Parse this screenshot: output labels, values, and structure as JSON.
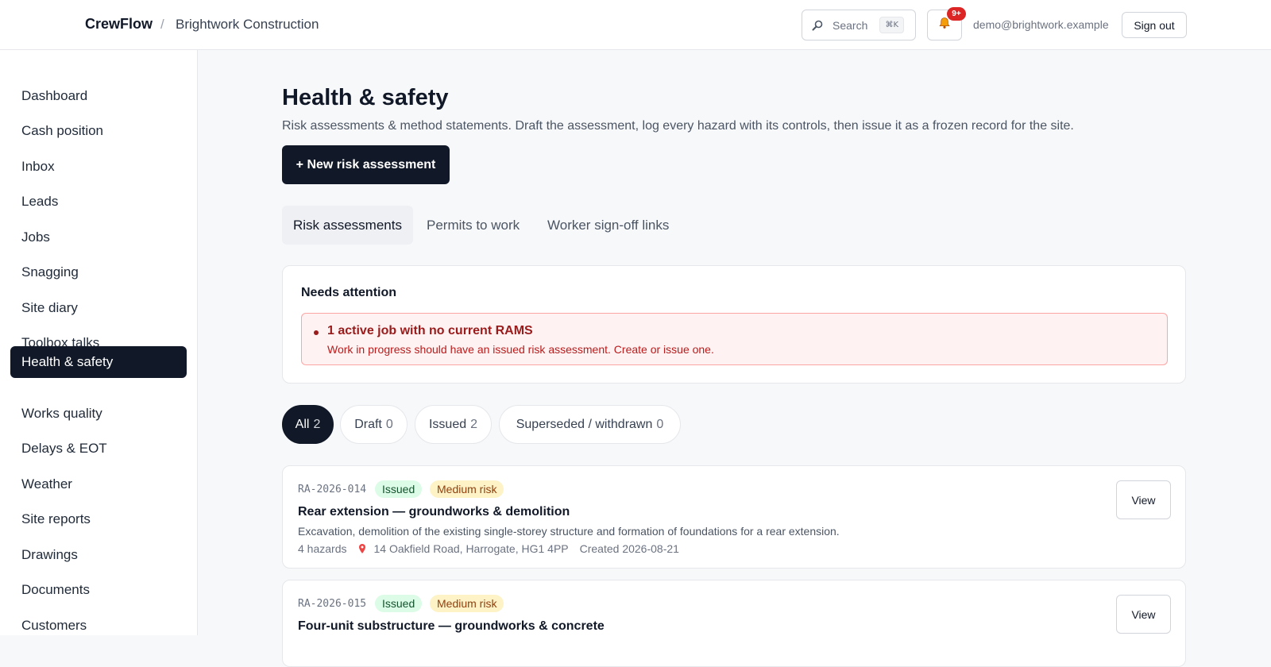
{
  "header": {
    "brand": "CrewFlow",
    "separator": "/",
    "org": "Brightwork Construction",
    "search_label": "Search",
    "search_shortcut": "⌘K",
    "notifications_count": "9+",
    "user_email": "demo@brightwork.example",
    "sign_out_label": "Sign out"
  },
  "sidebar": {
    "items": [
      {
        "label": "Dashboard"
      },
      {
        "label": "Cash position"
      },
      {
        "label": "Inbox"
      },
      {
        "label": "Leads"
      },
      {
        "label": "Jobs"
      },
      {
        "label": "Snagging"
      },
      {
        "label": "Site diary"
      },
      {
        "label": "Toolbox talks"
      },
      {
        "label": "Health & safety",
        "active": true
      },
      {
        "label": "Works quality"
      },
      {
        "label": "Delays & EOT"
      },
      {
        "label": "Weather"
      },
      {
        "label": "Site reports"
      },
      {
        "label": "Drawings"
      },
      {
        "label": "Documents"
      },
      {
        "label": "Customers"
      }
    ]
  },
  "main": {
    "title": "Health & safety",
    "subtitle": "Risk assessments & method statements. Draft the assessment, log every hazard with its controls, then issue it as a frozen record for the site.",
    "new_button": "+ New risk assessment",
    "tabs": [
      {
        "label": "Risk assessments",
        "active": true
      },
      {
        "label": "Permits to work"
      },
      {
        "label": "Worker sign-off links"
      }
    ],
    "attention": {
      "title": "Needs attention",
      "alert_title": "1 active job with no current RAMS",
      "alert_text": "Work in progress should have an issued risk assessment. Create or issue one."
    },
    "filters": [
      {
        "label": "All",
        "count": "2",
        "active": true
      },
      {
        "label": "Draft",
        "count": "0"
      },
      {
        "label": "Issued",
        "count": "2"
      },
      {
        "label": "Superseded / withdrawn",
        "count": "0"
      }
    ],
    "assessments": [
      {
        "code": "RA-2026-014",
        "status": "Issued",
        "risk": "Medium risk",
        "title": "Rear extension — groundworks & demolition",
        "description": "Excavation, demolition of the existing single-storey structure and formation of foundations for a rear extension.",
        "hazards": "4 hazards",
        "address": "14 Oakfield Road, Harrogate, HG1 4PP",
        "created": "Created 2026-08-21",
        "view_label": "View"
      },
      {
        "code": "RA-2026-015",
        "status": "Issued",
        "risk": "Medium risk",
        "title": "Four-unit substructure — groundworks & concrete",
        "view_label": "View"
      }
    ]
  },
  "colors": {
    "primary": "#111827",
    "alert_bg": "#fef2f2",
    "alert_text": "#991b1b",
    "issued_bg": "#dcfce7",
    "medium_bg": "#fef3c7"
  }
}
